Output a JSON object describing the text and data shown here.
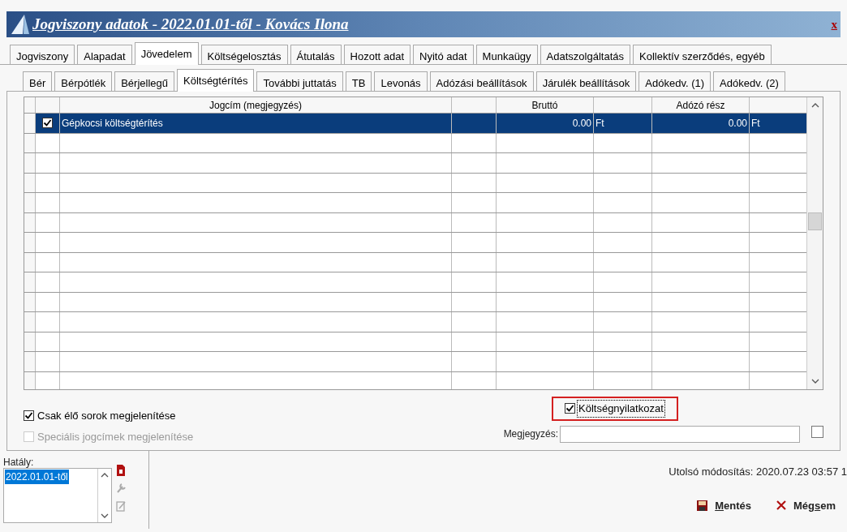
{
  "window": {
    "title": "Jogviszony adatok - 2022.01.01-től - Kovács Ilona",
    "close": "x"
  },
  "main_tabs": [
    {
      "label": "Jogviszony",
      "selected": false
    },
    {
      "label": "Alapadat",
      "selected": false
    },
    {
      "label": "Jövedelem",
      "selected": true
    },
    {
      "label": "Költségelosztás",
      "selected": false
    },
    {
      "label": "Átutalás",
      "selected": false
    },
    {
      "label": "Hozott adat",
      "selected": false
    },
    {
      "label": "Nyitó adat",
      "selected": false
    },
    {
      "label": "Munkaügy",
      "selected": false
    },
    {
      "label": "Adatszolgáltatás",
      "selected": false
    },
    {
      "label": "Kollektív szerződés, egyéb",
      "selected": false
    }
  ],
  "sub_tabs": [
    {
      "label": "Bér",
      "selected": false
    },
    {
      "label": "Bérpótlék",
      "selected": false
    },
    {
      "label": "Bérjellegű",
      "selected": false
    },
    {
      "label": "Költségtérítés",
      "selected": true
    },
    {
      "label": "További juttatás",
      "selected": false
    },
    {
      "label": "TB",
      "selected": false
    },
    {
      "label": "Levonás",
      "selected": false
    },
    {
      "label": "Adózási beállítások",
      "selected": false
    },
    {
      "label": "Járulék beállítások",
      "selected": false
    },
    {
      "label": "Adókedv. (1)",
      "selected": false
    },
    {
      "label": "Adókedv. (2)",
      "selected": false
    }
  ],
  "grid": {
    "columns": [
      {
        "label": "Jogcím (megjegyzés)"
      },
      {
        "label": "Bruttó"
      },
      {
        "label": "Adózó rész"
      }
    ],
    "rows": [
      {
        "checked": true,
        "selected": true,
        "title": "Gépkocsi költségtérítés",
        "brutto": "0.00",
        "brutto_unit": "Ft",
        "adozo": "0.00",
        "adozo_unit": "Ft"
      }
    ]
  },
  "options": [
    {
      "label": "Csak élő sorok megjelenítése",
      "checked": true,
      "disabled": false
    },
    {
      "label": "Speciális jogcímek megjelenítése",
      "checked": false,
      "disabled": true
    }
  ],
  "declaration": {
    "label": "Költségnyilatkozat",
    "checked": true,
    "highlighted": true
  },
  "note": {
    "label": "Megjegyzés:",
    "checked": false
  },
  "validity": {
    "label": "Hatály:",
    "items": [
      {
        "label": "2022.01.01-től",
        "selected": true
      }
    ]
  },
  "last_modified": "Utolsó módosítás: 2020.07.23 03:57 1",
  "buttons": [
    {
      "kind": "save",
      "accel": "M",
      "after": "entés"
    },
    {
      "kind": "cancel",
      "before": "Még",
      "accel": "s",
      "after": "em"
    }
  ]
}
